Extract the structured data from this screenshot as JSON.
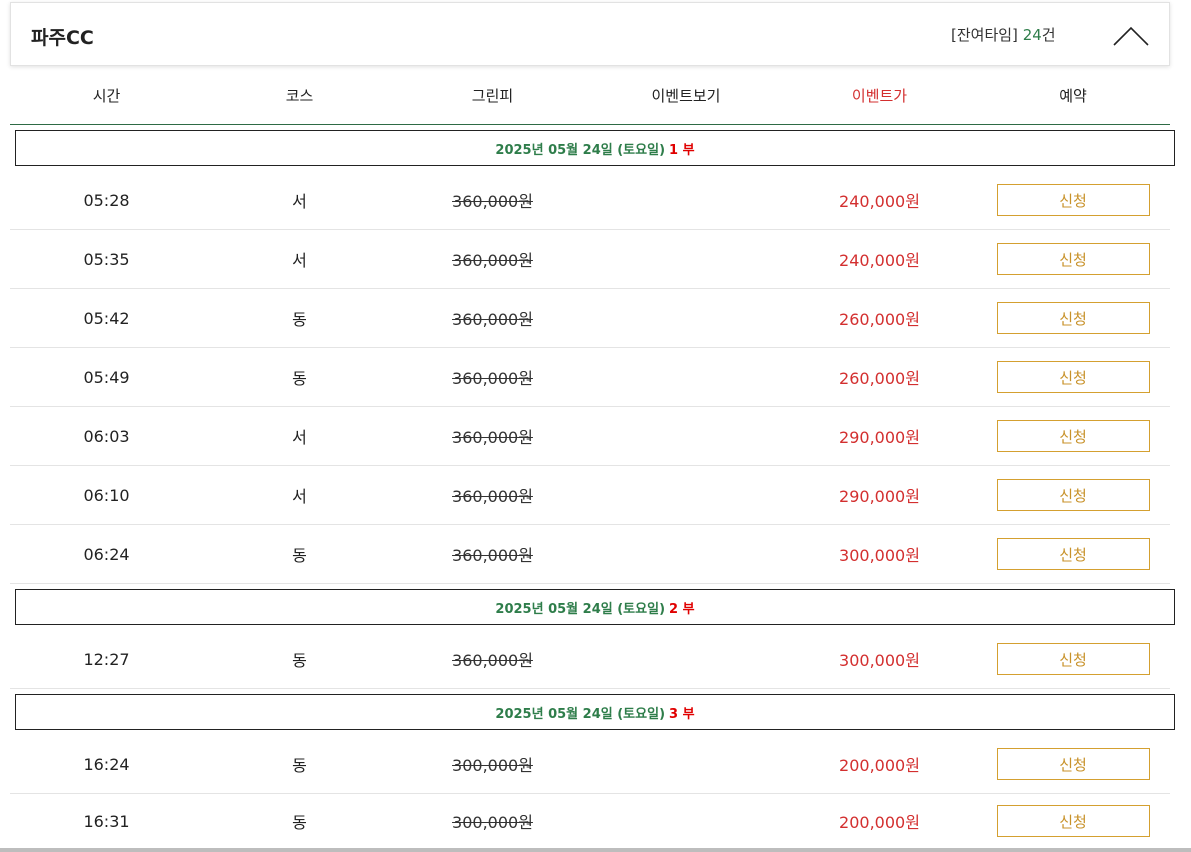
{
  "header": {
    "title": "파주CC",
    "remain_prefix": "[잔여타임]",
    "remain_count": "24",
    "remain_unit": "건",
    "collapse_icon": "chevron-up-icon"
  },
  "columns": {
    "time": "시간",
    "course": "코스",
    "green_fee": "그린피",
    "event_view": "이벤트보기",
    "event_price": "이벤트가",
    "reserve": "예약"
  },
  "sessions": [
    {
      "date": "2025년 05월 24일 (토요일)",
      "part": "1 부"
    },
    {
      "date": "2025년 05월 24일 (토요일)",
      "part": "2 부"
    },
    {
      "date": "2025년 05월 24일 (토요일)",
      "part": "3 부"
    }
  ],
  "rows": [
    {
      "time": "05:28",
      "course": "서",
      "green_fee": "360,000원",
      "event_view": "",
      "event_price": "240,000원",
      "action": "신청"
    },
    {
      "time": "05:35",
      "course": "서",
      "green_fee": "360,000원",
      "event_view": "",
      "event_price": "240,000원",
      "action": "신청"
    },
    {
      "time": "05:42",
      "course": "동",
      "green_fee": "360,000원",
      "event_view": "",
      "event_price": "260,000원",
      "action": "신청"
    },
    {
      "time": "05:49",
      "course": "동",
      "green_fee": "360,000원",
      "event_view": "",
      "event_price": "260,000원",
      "action": "신청"
    },
    {
      "time": "06:03",
      "course": "서",
      "green_fee": "360,000원",
      "event_view": "",
      "event_price": "290,000원",
      "action": "신청"
    },
    {
      "time": "06:10",
      "course": "서",
      "green_fee": "360,000원",
      "event_view": "",
      "event_price": "290,000원",
      "action": "신청"
    },
    {
      "time": "06:24",
      "course": "동",
      "green_fee": "360,000원",
      "event_view": "",
      "event_price": "300,000원",
      "action": "신청"
    },
    {
      "time": "12:27",
      "course": "동",
      "green_fee": "360,000원",
      "event_view": "",
      "event_price": "300,000원",
      "action": "신청"
    },
    {
      "time": "16:24",
      "course": "동",
      "green_fee": "300,000원",
      "event_view": "",
      "event_price": "200,000원",
      "action": "신청"
    },
    {
      "time": "16:31",
      "course": "동",
      "green_fee": "300,000원",
      "event_view": "",
      "event_price": "200,000원",
      "action": "신청"
    }
  ],
  "colors": {
    "accent_green": "#2e7d4a",
    "event_red": "#d32f2f",
    "part_red": "#e00000",
    "button_gold": "#c8922a"
  }
}
